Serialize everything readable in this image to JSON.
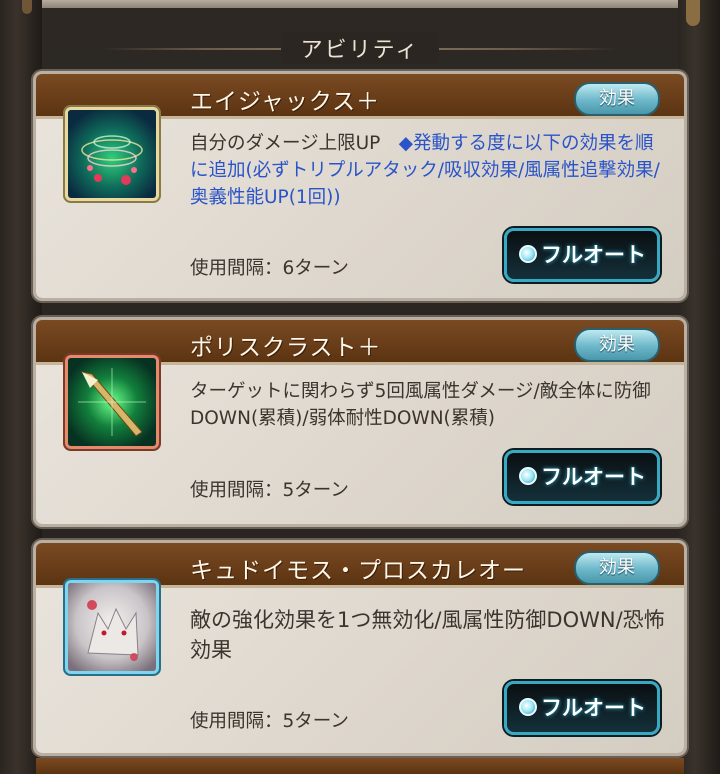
{
  "section": {
    "title": "アビリティ"
  },
  "abilities": [
    {
      "name": "エイジャックス＋",
      "effect_label": "効果",
      "desc_black": "自分のダメージ上限UP　",
      "desc_blue": "◆発動する度に以下の効果を順に追加(必ずトリプルアタック/吸収効果/風属性追撃効果/奥義性能UP(1回))",
      "interval": "使用間隔：6ターン",
      "auto_label": "フルオート",
      "icon": "rose-whirlwind-icon"
    },
    {
      "name": "ポリスクラスト＋",
      "effect_label": "効果",
      "desc_black": "ターゲットに関わらず5回風属性ダメージ/敵全体に防御DOWN(累積)/弱体耐性DOWN(累積)",
      "desc_blue": "",
      "interval": "使用間隔：5ターン",
      "auto_label": "フルオート",
      "icon": "spear-strike-icon"
    },
    {
      "name": "キュドイモス・プロスカレオー",
      "effect_label": "効果",
      "desc_black": "敵の強化効果を1つ無効化/風属性防御DOWN/恐怖効果",
      "desc_blue": "",
      "interval": "使用間隔：5ターン",
      "auto_label": "フルオート",
      "icon": "spirit-wolf-icon"
    }
  ],
  "colors": {
    "band": "#6a3d18",
    "effect_button": "#6cb7c9",
    "auto_border": "#39a9c2",
    "desc_blue": "#2a54c8"
  }
}
